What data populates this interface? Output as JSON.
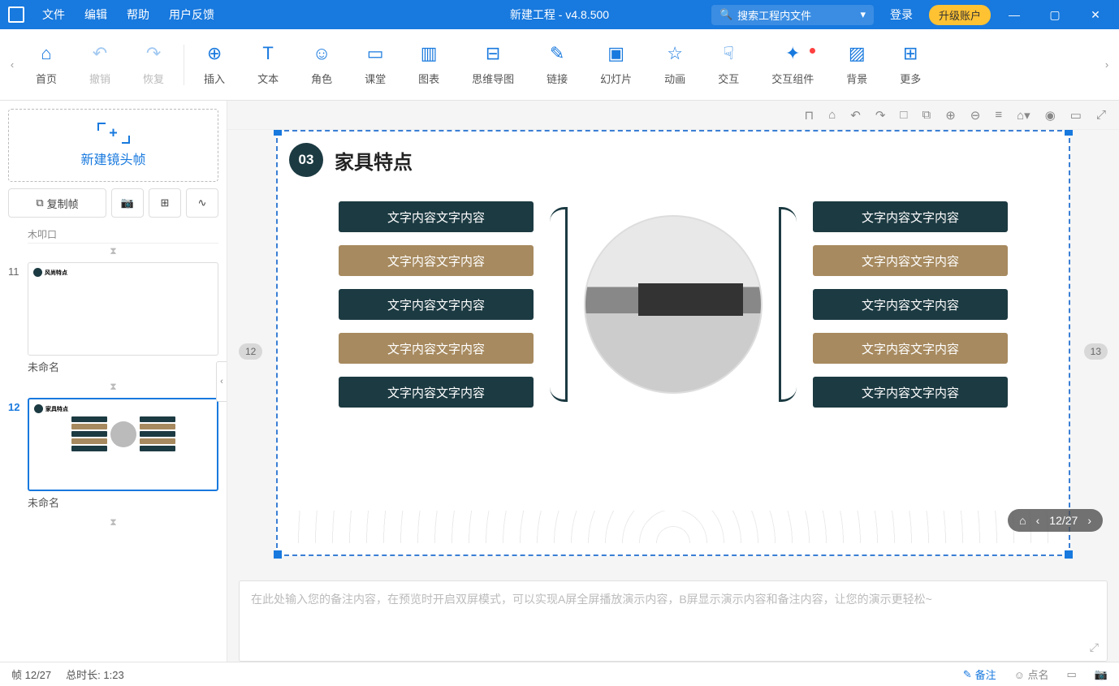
{
  "titlebar": {
    "menus": [
      "文件",
      "编辑",
      "帮助",
      "用户反馈"
    ],
    "title": "新建工程 - v4.8.500",
    "search_placeholder": "搜索工程内文件",
    "login": "登录",
    "upgrade": "升级账户"
  },
  "toolbar": {
    "items": [
      {
        "label": "首页",
        "icon": "⌂"
      },
      {
        "label": "撤销",
        "icon": "↶",
        "disabled": true
      },
      {
        "label": "恢复",
        "icon": "↷",
        "disabled": true
      },
      {
        "label": "插入",
        "icon": "⊕",
        "sep_before": true
      },
      {
        "label": "文本",
        "icon": "T"
      },
      {
        "label": "角色",
        "icon": "☺"
      },
      {
        "label": "课堂",
        "icon": "▭"
      },
      {
        "label": "图表",
        "icon": "▥"
      },
      {
        "label": "思维导图",
        "icon": "⊟"
      },
      {
        "label": "链接",
        "icon": "✎"
      },
      {
        "label": "幻灯片",
        "icon": "▣"
      },
      {
        "label": "动画",
        "icon": "☆"
      },
      {
        "label": "交互",
        "icon": "☟"
      },
      {
        "label": "交互组件",
        "icon": "✦",
        "dot": true
      },
      {
        "label": "背景",
        "icon": "▨"
      },
      {
        "label": "更多",
        "icon": "⊞"
      }
    ]
  },
  "sub_toolbar_icons": [
    "⊓",
    "⌂",
    "↶",
    "↷",
    "□",
    "⧉",
    "⊕",
    "⊖",
    "≡",
    "⌂▾",
    "◉",
    "▭",
    "⤢"
  ],
  "sidebar": {
    "new_frame": "新建镜头帧",
    "copy_frame": "复制帧",
    "slides": [
      {
        "num": "11",
        "name": "未命名"
      },
      {
        "num": "12",
        "name": "未命名",
        "active": true
      }
    ]
  },
  "canvas": {
    "prev_num": "12",
    "next_num": "13",
    "badge": "03",
    "title": "家具特点",
    "pill_text": "文字内容文字内容",
    "float_counter": "12/27"
  },
  "notes_placeholder": "在此处输入您的备注内容，在预览时开启双屏模式，可以实现A屏全屏播放演示内容，B屏显示演示内容和备注内容，让您的演示更轻松~",
  "statusbar": {
    "frame": "帧 12/27",
    "duration": "总时长: 1:23",
    "notes": "备注",
    "roll": "点名"
  }
}
